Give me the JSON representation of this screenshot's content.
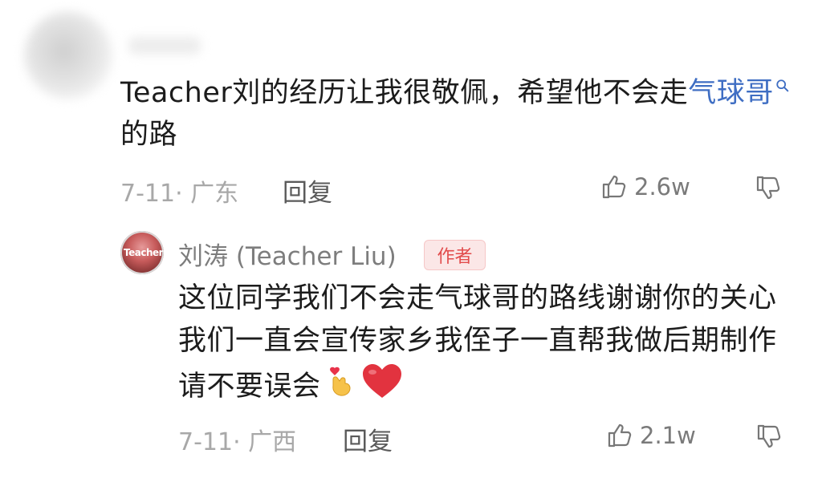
{
  "comment1": {
    "text_before_link": "Teacher刘的经历让我很敬佩，希望他不会走",
    "link_text": "气球哥",
    "text_after_link": "的路",
    "date": "7-11· 广东",
    "reply_label": "回复",
    "likes": "2.6w"
  },
  "reply1": {
    "author": "刘涛 (Teacher Liu)",
    "author_badge": "作者",
    "avatar_text": "Teacher",
    "text": "这位同学我们不会走气球哥的路线谢谢你的关心我们一直会宣传家乡我侄子一直帮我做后期制作请不要误会",
    "date": "7-11· 广西",
    "reply_label": "回复",
    "likes": "2.1w"
  },
  "colors": {
    "link": "#3f6ec3",
    "badge_text": "#e24b4b",
    "badge_bg": "#fbe7e7"
  },
  "icons": [
    "thumbs-up-icon",
    "thumbs-down-icon",
    "search-icon",
    "finger-heart-emoji",
    "red-heart-emoji"
  ]
}
